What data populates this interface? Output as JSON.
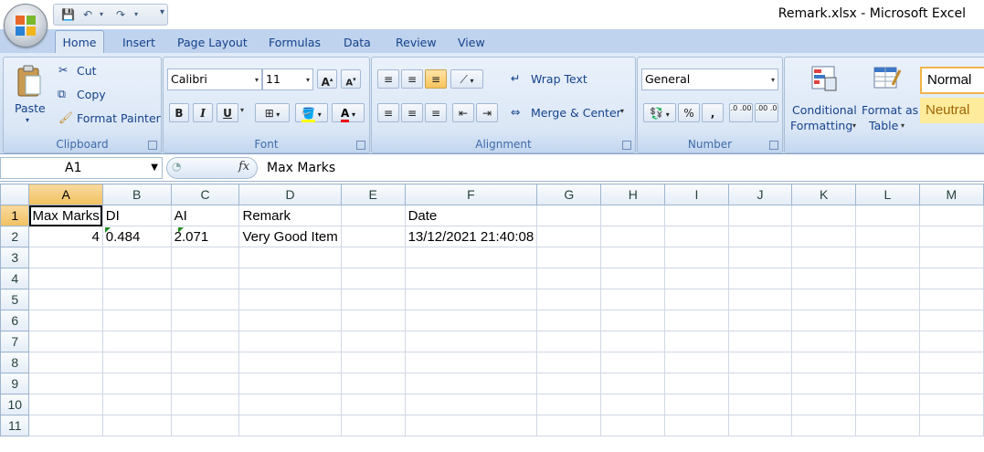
{
  "window": {
    "title": "Remark.xlsx - Microsoft Excel"
  },
  "tabs": [
    "Home",
    "Insert",
    "Page Layout",
    "Formulas",
    "Data",
    "Review",
    "View"
  ],
  "ribbon": {
    "clipboard": {
      "label": "Clipboard",
      "paste": "Paste",
      "cut": "Cut",
      "copy": "Copy",
      "format_painter": "Format Painter"
    },
    "font": {
      "label": "Font",
      "family": "Calibri",
      "size": "11",
      "bold": "B",
      "italic": "I",
      "underline": "U",
      "grow": "A",
      "shrink": "A",
      "font_color": "A"
    },
    "alignment": {
      "label": "Alignment",
      "wrap_text": "Wrap Text",
      "merge_center": "Merge & Center"
    },
    "number": {
      "label": "Number",
      "format": "General",
      "percent": "%",
      "comma": ",",
      "inc_decimal": ".0 .00",
      "dec_decimal": ".00 .0"
    },
    "styles": {
      "conditional_formatting": "Conditional\nFormatting",
      "cf_line1": "Conditional",
      "cf_line2": "Formatting",
      "format_as_table_line1": "Format as",
      "format_as_table_line2": "Table",
      "normal": "Normal",
      "neutral": "Neutral"
    }
  },
  "formula_bar": {
    "name_box": "A1",
    "fx": "fx",
    "content": "Max Marks"
  },
  "sheet": {
    "columns": [
      "A",
      "B",
      "C",
      "D",
      "E",
      "F",
      "G",
      "H",
      "I",
      "J",
      "K",
      "L",
      "M"
    ],
    "rows": [
      "1",
      "2",
      "3",
      "4",
      "5",
      "6",
      "7",
      "8",
      "9",
      "10",
      "11"
    ],
    "cells": {
      "A1": "Max Marks",
      "B1": "DI",
      "C1": "AI",
      "D1": "Remark",
      "F1": "Date",
      "A2": "4",
      "B2": "0.484",
      "C2": "2.071",
      "D2": "Very Good Item",
      "F2": "13/12/2021 21:40:08"
    }
  },
  "colors": {
    "ribbon": "#dbe7f6",
    "tab_text": "#15428b",
    "selected_header": "#f1c15f",
    "grid_line": "#d0d7e5",
    "neutral_bg": "#ffeb9c"
  }
}
